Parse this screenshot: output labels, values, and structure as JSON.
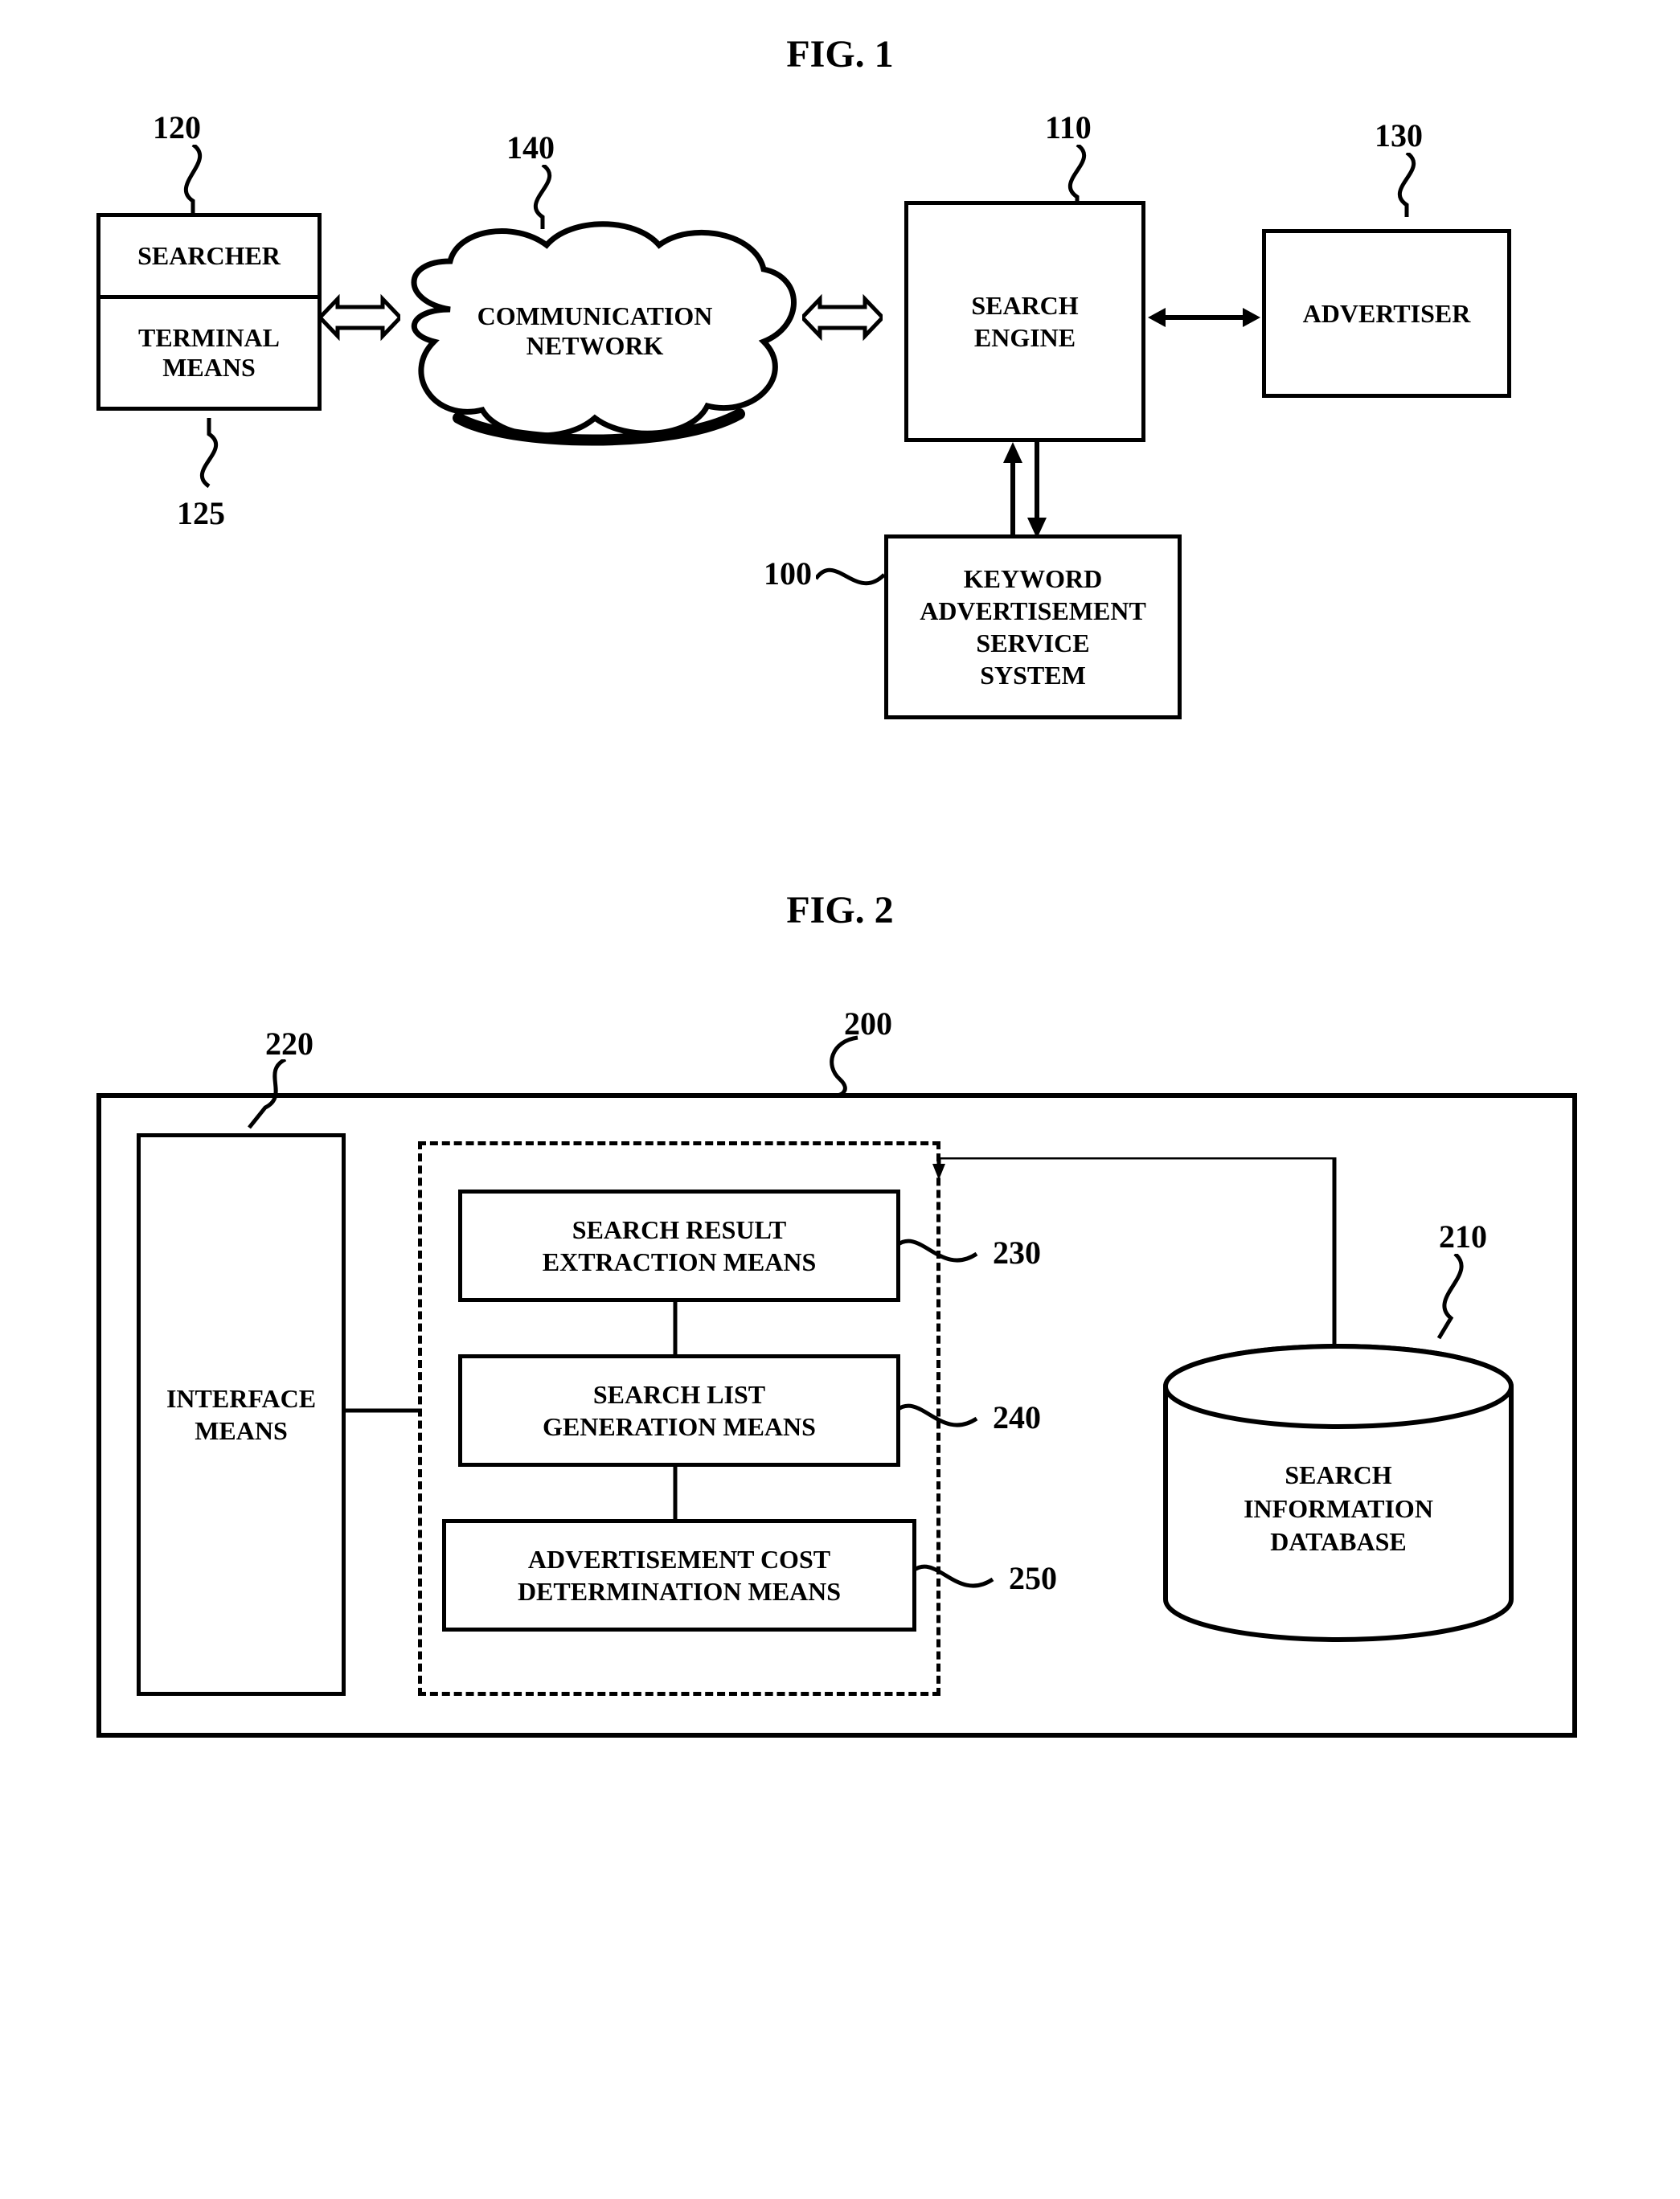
{
  "fig1": {
    "title": "FIG. 1",
    "labels": {
      "n120": "120",
      "n125": "125",
      "n140": "140",
      "n110": "110",
      "n130": "130",
      "n100": "100"
    },
    "boxes": {
      "searcher": "SEARCHER",
      "terminal": "TERMINAL MEANS",
      "cloud_l1": "COMMUNICATION",
      "cloud_l2": "NETWORK",
      "search_engine_l1": "SEARCH",
      "search_engine_l2": "ENGINE",
      "advertiser": "ADVERTISER",
      "kass_l1": "KEYWORD",
      "kass_l2": "ADVERTISEMENT",
      "kass_l3": "SERVICE",
      "kass_l4": "SYSTEM"
    }
  },
  "fig2": {
    "title": "FIG. 2",
    "labels": {
      "n200": "200",
      "n220": "220",
      "n230": "230",
      "n240": "240",
      "n250": "250",
      "n210": "210"
    },
    "boxes": {
      "interface_l1": "INTERFACE",
      "interface_l2": "MEANS",
      "sre_l1": "SEARCH RESULT",
      "sre_l2": "EXTRACTION MEANS",
      "slg_l1": "SEARCH LIST",
      "slg_l2": "GENERATION MEANS",
      "acd_l1": "ADVERTISEMENT COST",
      "acd_l2": "DETERMINATION MEANS",
      "db_l1": "SEARCH",
      "db_l2": "INFORMATION",
      "db_l3": "DATABASE"
    }
  }
}
